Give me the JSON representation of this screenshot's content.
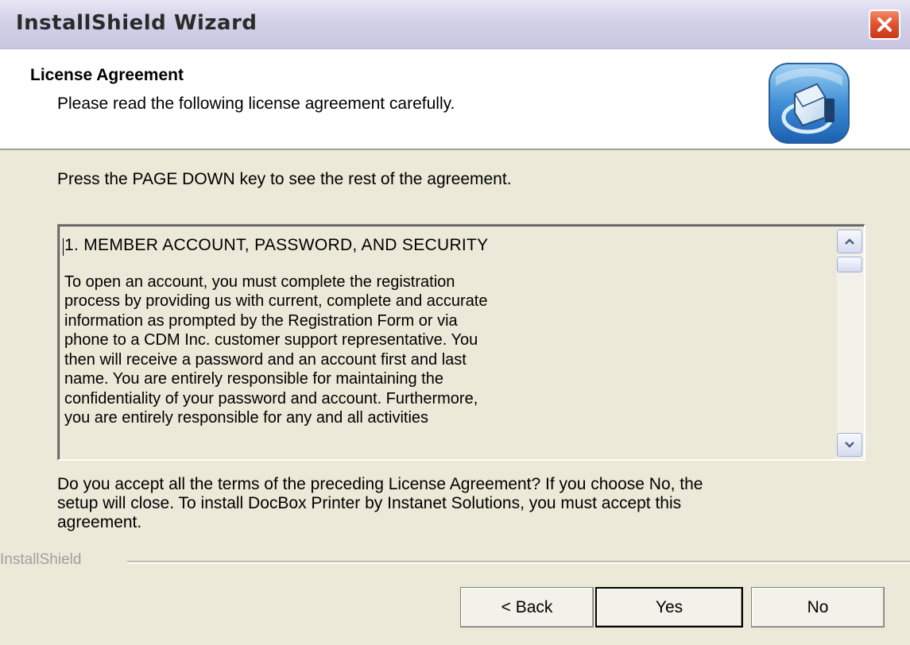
{
  "window": {
    "title": "InstallShield Wizard"
  },
  "header": {
    "title": "License Agreement",
    "subtitle": "Please read the following license agreement carefully."
  },
  "body": {
    "pagedown_instruction": "Press the PAGE DOWN key to see the rest of the agreement.",
    "license_heading": "1. MEMBER ACCOUNT, PASSWORD, AND SECURITY",
    "license_paragraph": "To open an account, you must complete the registration\nprocess by providing us with current, complete and accurate\ninformation as prompted by the Registration Form or via\nphone to a CDM Inc. customer support representative. You\nthen will receive a password and an account first and last\nname. You are entirely responsible for maintaining the\nconfidentiality of your password and account. Furthermore,\nyou are entirely responsible for any and all activities",
    "question": "Do you accept all the terms of the preceding License Agreement?  If you choose No,  the\nsetup will close.  To install DocBox Printer by Instanet Solutions, you must accept this\nagreement."
  },
  "footer": {
    "brand": "InstallShield",
    "back_label": "< Back",
    "yes_label": "Yes",
    "no_label": "No"
  }
}
